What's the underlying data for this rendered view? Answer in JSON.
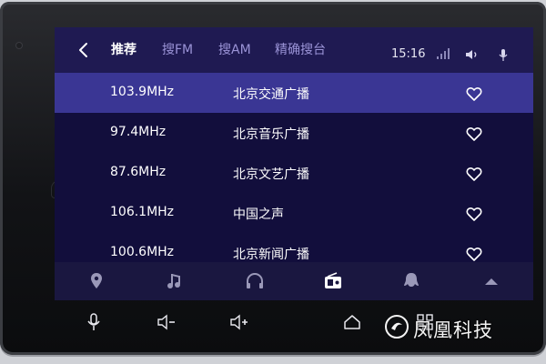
{
  "header": {
    "tabs": [
      {
        "label": "推荐",
        "active": true
      },
      {
        "label": "搜FM",
        "active": false
      },
      {
        "label": "搜AM",
        "active": false
      },
      {
        "label": "精确搜台",
        "active": false
      }
    ],
    "time": "15:16"
  },
  "stations": [
    {
      "freq": "103.9MHz",
      "name": "北京交通广播",
      "selected": true
    },
    {
      "freq": "97.4MHz",
      "name": "北京音乐广播",
      "selected": false
    },
    {
      "freq": "87.6MHz",
      "name": "北京文艺广播",
      "selected": false
    },
    {
      "freq": "106.1MHz",
      "name": "中国之声",
      "selected": false
    },
    {
      "freq": "100.6MHz",
      "name": "北京新闻广播",
      "selected": false
    }
  ],
  "bottom_nav": {
    "items": [
      "location-icon",
      "music-icon",
      "headphones-icon",
      "radio-icon",
      "chat-icon",
      "up-arrow-icon"
    ],
    "active": "radio-icon"
  },
  "hardware_controls": [
    "microphone-icon",
    "volume-down-icon",
    "volume-up-icon",
    "home-icon",
    "apps-icon"
  ],
  "watermark": {
    "text": "凤凰科技"
  },
  "colors": {
    "screen_bg": "#120e3c",
    "header_bg": "#1f1a52",
    "selected_row": "#3a3694",
    "inactive_tab": "#9a93d6",
    "nav_bg": "#1a1740"
  }
}
